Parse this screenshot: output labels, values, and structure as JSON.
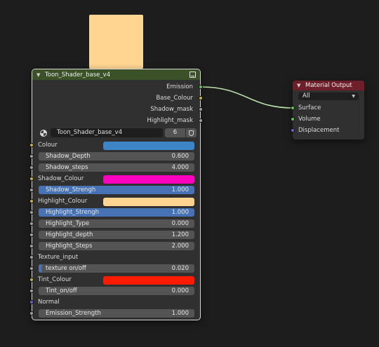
{
  "colors": {
    "preview": "#ffd591",
    "group_header": "#3b5228",
    "output_header": "#6e1f2a",
    "socket_color": "#c9b23f",
    "socket_float": "#a1a1a1",
    "socket_shader": "#5fc25a",
    "socket_vector": "#6363c7",
    "field_active": "#4772b3",
    "colour_swatch": "#3d85c6",
    "shadow_colour_swatch": "#ff00bf",
    "highlight_colour_swatch": "#ffd591",
    "tint_colour_swatch": "#ff1a00"
  },
  "group_node": {
    "title": "Toon_Shader_base_v4",
    "outputs": [
      "Emission",
      "Base_Colour",
      "Shadow_mask",
      "Highlight_mask"
    ],
    "datablock_name": "Toon_Shader_base_v4",
    "datablock_users": "6",
    "inputs": {
      "colour_label": "Colour",
      "shadow_depth_label": "Shadow_Depth",
      "shadow_depth_value": "0.600",
      "shadow_steps_label": "Shadow_steps",
      "shadow_steps_value": "4.000",
      "shadow_colour_label": "Shadow_Colour",
      "shadow_strength_label": "Shadow_Strengh",
      "shadow_strength_value": "1.000",
      "highlight_colour_label": "Highlight_Colour",
      "highlight_strength_label": "Highlight_Strengh",
      "highlight_strength_value": "1.000",
      "highlight_type_label": "Highlight_Type",
      "highlight_type_value": "0.000",
      "highlight_depth_label": "Highlight_depth",
      "highlight_depth_value": "1.200",
      "highlight_steps_label": "Highlight_Steps",
      "highlight_steps_value": "2.000",
      "texture_input_label": "Texture_input",
      "texture_onoff_label": "texture on/off",
      "texture_onoff_value": "0.020",
      "tint_colour_label": "Tint_Colour",
      "tint_onoff_label": "Tint_on/off",
      "tint_onoff_value": "0.000",
      "normal_label": "Normal",
      "emission_strength_label": "Emission_Strength",
      "emission_strength_value": "1.000"
    }
  },
  "output_node": {
    "title": "Material Output",
    "target": "All",
    "inputs": [
      "Surface",
      "Volume",
      "Displacement"
    ]
  }
}
